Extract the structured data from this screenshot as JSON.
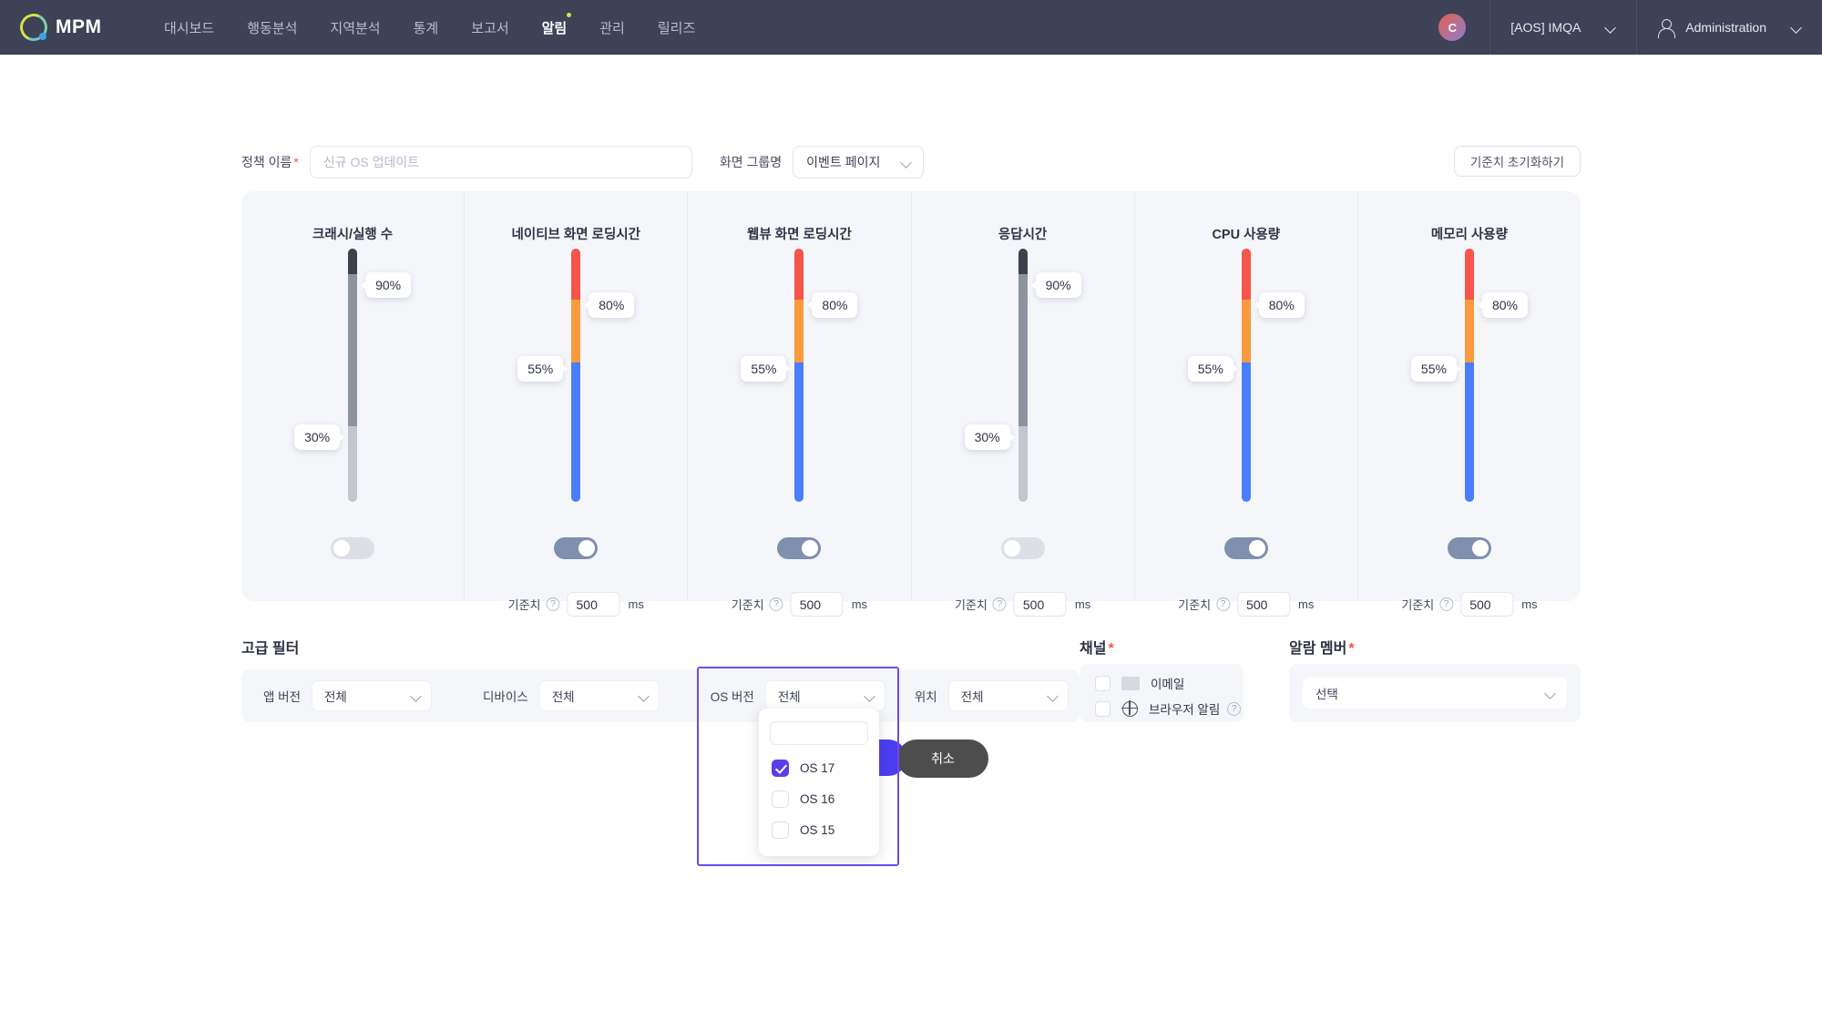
{
  "brand": {
    "name": "MPM",
    "logo_icon": "mpm-logo-icon"
  },
  "nav": {
    "items": [
      {
        "label": "대시보드",
        "active": false,
        "dot": false
      },
      {
        "label": "행동분석",
        "active": false,
        "dot": false
      },
      {
        "label": "지역분석",
        "active": false,
        "dot": false
      },
      {
        "label": "통계",
        "active": false,
        "dot": false
      },
      {
        "label": "보고서",
        "active": false,
        "dot": false
      },
      {
        "label": "알림",
        "active": true,
        "dot": true
      },
      {
        "label": "관리",
        "active": false,
        "dot": false
      },
      {
        "label": "릴리즈",
        "active": false,
        "dot": false
      }
    ]
  },
  "topbar_right": {
    "avatar_initial": "C",
    "project_selector": "[AOS] IMQA",
    "user_selector": "Administration",
    "user_icon": "user-icon",
    "chevron_icon": "chevron-down-icon"
  },
  "form": {
    "policy_name_label": "정책 이름",
    "policy_name_placeholder": "신규 OS 업데이트",
    "policy_name_value": "",
    "screen_group_label": "화면 그룹명",
    "screen_group_value": "이벤트 페이지",
    "reset_button": "기준치 초기화하기"
  },
  "metrics": {
    "threshold_label": "기준치",
    "threshold_value": "500",
    "threshold_unit": "ms",
    "help_icon": "question-mark-icon",
    "columns": [
      {
        "title": "크래시/실행 수",
        "enabled": false,
        "upper": "90%",
        "lower": "30%",
        "upper_pct": 90,
        "lower_pct": 30,
        "has_threshold": false,
        "upper_side": "right",
        "lower_side": "left"
      },
      {
        "title": "네이티브 화면 로딩시간",
        "enabled": true,
        "upper": "80%",
        "lower": "55%",
        "upper_pct": 80,
        "lower_pct": 55,
        "has_threshold": true,
        "upper_side": "right",
        "lower_side": "left"
      },
      {
        "title": "웹뷰 화면 로딩시간",
        "enabled": true,
        "upper": "80%",
        "lower": "55%",
        "upper_pct": 80,
        "lower_pct": 55,
        "has_threshold": true,
        "upper_side": "right",
        "lower_side": "left"
      },
      {
        "title": "응답시간",
        "enabled": false,
        "upper": "90%",
        "lower": "30%",
        "upper_pct": 90,
        "lower_pct": 30,
        "has_threshold": true,
        "upper_side": "right",
        "lower_side": "left"
      },
      {
        "title": "CPU 사용량",
        "enabled": true,
        "upper": "80%",
        "lower": "55%",
        "upper_pct": 80,
        "lower_pct": 55,
        "has_threshold": true,
        "upper_side": "right",
        "lower_side": "left"
      },
      {
        "title": "메모리 사용량",
        "enabled": true,
        "upper": "80%",
        "lower": "55%",
        "upper_pct": 80,
        "lower_pct": 55,
        "has_threshold": true,
        "upper_side": "right",
        "lower_side": "left"
      }
    ],
    "colors": {
      "high": "#f5554a",
      "mid": "#f99a3e",
      "low": "#4a7efc",
      "disabled_high": "#3d414c",
      "disabled_mid": "#8e93a0",
      "disabled_low": "#c3c6cd"
    }
  },
  "advanced_filter": {
    "title": "고급 필터",
    "fields": [
      {
        "label": "앱 버전",
        "value": "전체"
      },
      {
        "label": "디바이스",
        "value": "전체"
      },
      {
        "label": "OS 버전",
        "value": "전체"
      },
      {
        "label": "위치",
        "value": "전체"
      }
    ],
    "os_dropdown": {
      "search_value": "",
      "options": [
        {
          "label": "OS 17",
          "checked": true
        },
        {
          "label": "OS 16",
          "checked": false
        },
        {
          "label": "OS 15",
          "checked": false
        }
      ]
    }
  },
  "actions": {
    "cancel": "취소"
  },
  "channel": {
    "title": "채널",
    "required_mark": "*",
    "items": [
      {
        "label": "이메일",
        "checked": false,
        "icon": "mail-icon",
        "help": false
      },
      {
        "label": "브라우저 알림",
        "checked": false,
        "icon": "globe-icon",
        "help": true
      }
    ]
  },
  "alarm_member": {
    "title": "알람 멤버",
    "required_mark": "*",
    "select_value": "선택"
  },
  "theme": {
    "nav_bg": "#3d4257",
    "accent": "#5b3ee8",
    "panel_bg": "#f4f6fa",
    "highlight_border": "#6b4de6"
  }
}
